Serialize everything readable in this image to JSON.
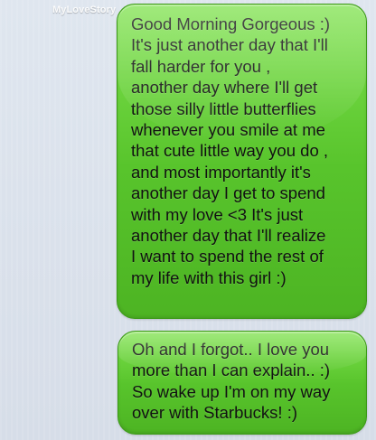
{
  "watermark": "MyLoveStory",
  "thread": {
    "messages": [
      {
        "lines": [
          "Good Morning Gorgeous :)",
          "It's just another day that I'll",
          "fall harder for you ,",
          "another day where I'll get",
          "those silly little butterflies",
          "whenever you smile at me",
          "that cute little way you do ,",
          "and most importantly it's",
          "another day I get to spend",
          "with my love <3 It's just",
          "another day that I'll realize",
          "I want to spend the rest of",
          "my life with this girl :)"
        ]
      },
      {
        "lines": [
          "Oh and I forgot.. I love you",
          "more than I can explain.. :)",
          "So wake up I'm on my way",
          "over with Starbucks! :)"
        ]
      }
    ]
  },
  "colors": {
    "background": "#dbe2ec",
    "bubble_green": "#58c42c",
    "text": "#111111"
  }
}
